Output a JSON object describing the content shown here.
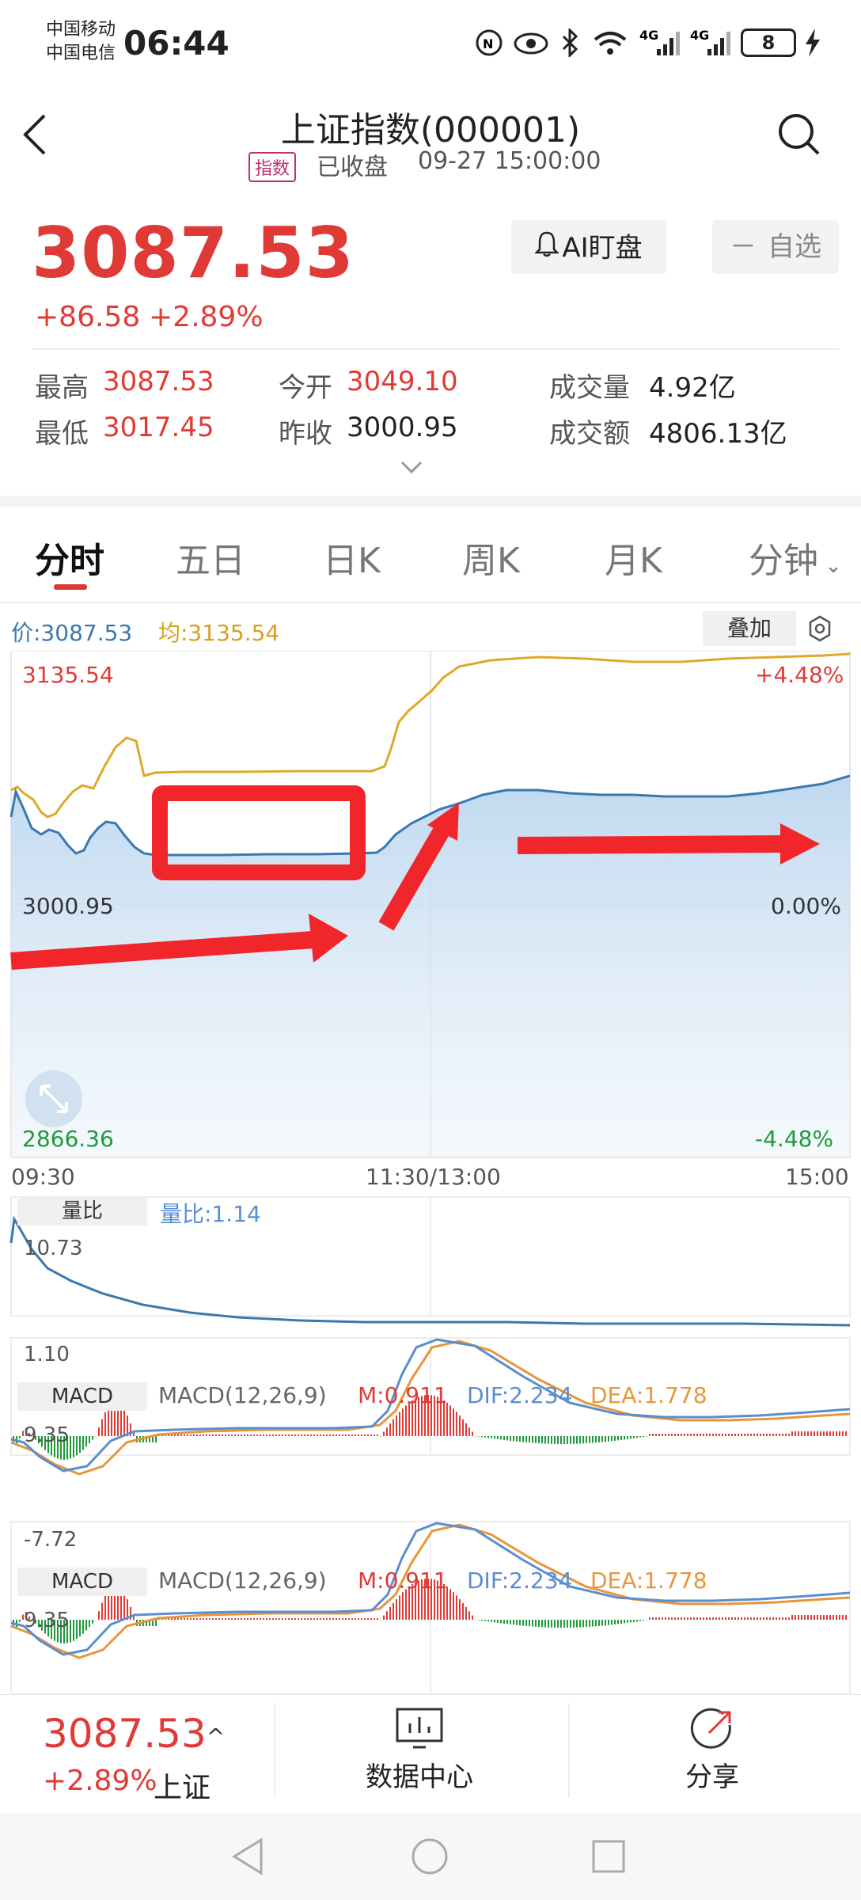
{
  "status_bar": {
    "carrier1": "中国移动",
    "carrier2": "中国电信",
    "time": "06:44",
    "battery": "8",
    "icons": [
      "nfc-icon",
      "eye-icon",
      "bluetooth-icon",
      "wifi-icon",
      "signal-4g-icon",
      "signal-4g-icon-2",
      "charging-icon"
    ]
  },
  "header": {
    "title": "上证指数(000001)",
    "badge": "指数",
    "status": "已收盘",
    "datetime": "09-27 15:00:00"
  },
  "quote": {
    "price": "3087.53",
    "change": "+86.58",
    "change_pct": "+2.89%",
    "ai_button": "AI盯盘",
    "watch_button": "自选",
    "watch_prefix": "－"
  },
  "stats": {
    "high_label": "最高",
    "high_value": "3087.53",
    "open_label": "今开",
    "open_value": "3049.10",
    "volume_label": "成交量",
    "volume_value": "4.92亿",
    "low_label": "最低",
    "low_value": "3017.45",
    "prev_label": "昨收",
    "prev_value": "3000.95",
    "amount_label": "成交额",
    "amount_value": "4806.13亿"
  },
  "tabs": [
    "分时",
    "五日",
    "日K",
    "周K",
    "月K",
    "分钟"
  ],
  "chart": {
    "price_label": "价:3087.53",
    "avg_label": "均:3135.54",
    "overlay_button": "叠加",
    "y_top": "3135.54",
    "y_mid": "3000.95",
    "y_bottom": "2866.36",
    "pct_top": "+4.48%",
    "pct_mid": "0.00%",
    "pct_bottom": "-4.48%",
    "x_start": "09:30",
    "x_mid": "11:30/13:00",
    "x_end": "15:00"
  },
  "volume_ratio": {
    "box_label": "量比",
    "value_label": "量比:1.14",
    "y_top": "10.73",
    "y_bottom": "1.10"
  },
  "macd1": {
    "box_label": "MACD",
    "params": "MACD(12,26,9)",
    "m": "M:0.911",
    "dif": "DIF:2.234",
    "dea": "DEA:1.778",
    "y_top": "9.35",
    "y_bottom": "-7.72"
  },
  "macd2": {
    "box_label": "MACD",
    "params": "MACD(12,26,9)",
    "m": "M:0.911",
    "dif": "DIF:2.234",
    "dea": "DEA:1.778",
    "y_top": "9.35"
  },
  "bottom": {
    "price": "3087.53",
    "caret": "^",
    "pct": "+2.89%",
    "name": "上证",
    "data_center": "数据中心",
    "share": "分享"
  },
  "colors": {
    "up_red": "#e03a36",
    "down_green": "#1e9a3a",
    "price_line": "#3a78b0",
    "avg_line": "#e0a82a",
    "dif_line": "#5a8ed0",
    "dea_line": "#e8963a",
    "annotation_red": "#f0262a"
  }
}
